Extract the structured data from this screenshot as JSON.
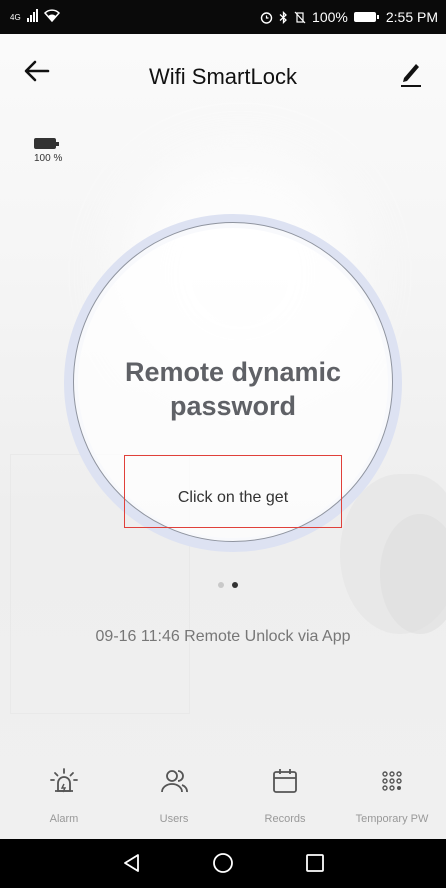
{
  "status_bar": {
    "network": "4G",
    "battery_percent": "100%",
    "time": "2:55 PM"
  },
  "header": {
    "title": "Wifi SmartLock",
    "back_icon": "arrow-left-icon",
    "edit_icon": "pencil-icon"
  },
  "lock_battery": {
    "text": "100 %",
    "level": 1.0
  },
  "main_card": {
    "title": "Remote dynamic password",
    "action_label": "Click on the get"
  },
  "pager": {
    "count": 2,
    "active_index": 1
  },
  "last_record": {
    "text": "09-16 11:46  Remote Unlock via App"
  },
  "bottom_nav": {
    "items": [
      {
        "label": "Alarm",
        "icon": "alarm-icon"
      },
      {
        "label": "Users",
        "icon": "users-icon"
      },
      {
        "label": "Records",
        "icon": "calendar-icon"
      },
      {
        "label": "Temporary PW",
        "icon": "keypad-icon"
      }
    ]
  },
  "colors": {
    "ring": "#dde2f2",
    "highlight_box": "#e0403a",
    "title_gray": "#5f6166",
    "nav_icon": "#555555"
  }
}
